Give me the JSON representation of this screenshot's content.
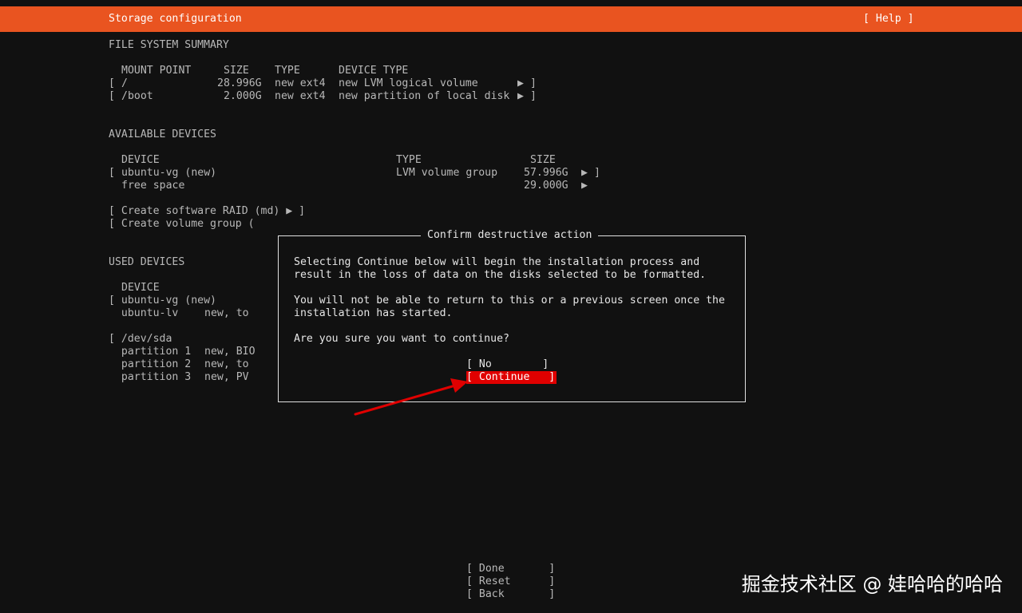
{
  "header": {
    "title": "Storage configuration",
    "help_label": "[ Help ]"
  },
  "fs_summary": {
    "heading": "FILE SYSTEM SUMMARY",
    "columns": [
      "MOUNT POINT",
      "SIZE",
      "TYPE",
      "DEVICE TYPE"
    ],
    "rows": [
      {
        "bracket": "[",
        "mount": "/",
        "size": "28.996G",
        "type": "new ext4",
        "device_type": "new LVM logical volume",
        "arrow": "▶",
        "close": "]"
      },
      {
        "bracket": "[",
        "mount": "/boot",
        "size": "2.000G",
        "type": "new ext4",
        "device_type": "new partition of local disk",
        "arrow": "▶",
        "close": "]"
      }
    ]
  },
  "available_devices": {
    "heading": "AVAILABLE DEVICES",
    "columns": [
      "DEVICE",
      "TYPE",
      "SIZE"
    ],
    "rows": [
      {
        "bracket": "[",
        "device": "ubuntu-vg (new)",
        "type": "LVM volume group",
        "size": "57.996G",
        "arrow": "▶",
        "close": "]"
      },
      {
        "bracket": "",
        "device": "free space",
        "type": "",
        "size": "29.000G",
        "arrow": "▶",
        "close": ""
      }
    ],
    "actions": [
      "[ Create software RAID (md) ▶ ]",
      "[ Create volume group ("
    ]
  },
  "used_devices": {
    "heading": "USED DEVICES",
    "column": "DEVICE",
    "lines": [
      {
        "col1": "[ ubuntu-vg (new)",
        "col2": ""
      },
      {
        "col1": "  ubuntu-lv",
        "col2": "new, to"
      },
      {
        "col1": "[ /dev/sda",
        "col2": ""
      },
      {
        "col1": "  partition 1",
        "col2": "new, BIO"
      },
      {
        "col1": "  partition 2",
        "col2": "new, to"
      },
      {
        "col1": "  partition 3",
        "col2": "new, PV"
      }
    ]
  },
  "dialog": {
    "title": "Confirm destructive action",
    "paragraph1": [
      "Selecting Continue below will begin the installation process and",
      "result in the loss of data on the disks selected to be formatted."
    ],
    "paragraph2": [
      "You will not be able to return to this or a previous screen once the",
      "installation has started."
    ],
    "question": "Are you sure you want to continue?",
    "no_label": "[ No        ]",
    "continue_label": "[ Continue   ]"
  },
  "footer": {
    "done_label": "[ Done       ]",
    "reset_label": "[ Reset      ]",
    "back_label": "[ Back       ]"
  },
  "watermark": "掘金技术社区 @ 娃哈哈的哈哈",
  "colors": {
    "header": "#e95420",
    "selected": "#e00000",
    "annotation_arrow": "#e00000",
    "background": "#111111"
  }
}
